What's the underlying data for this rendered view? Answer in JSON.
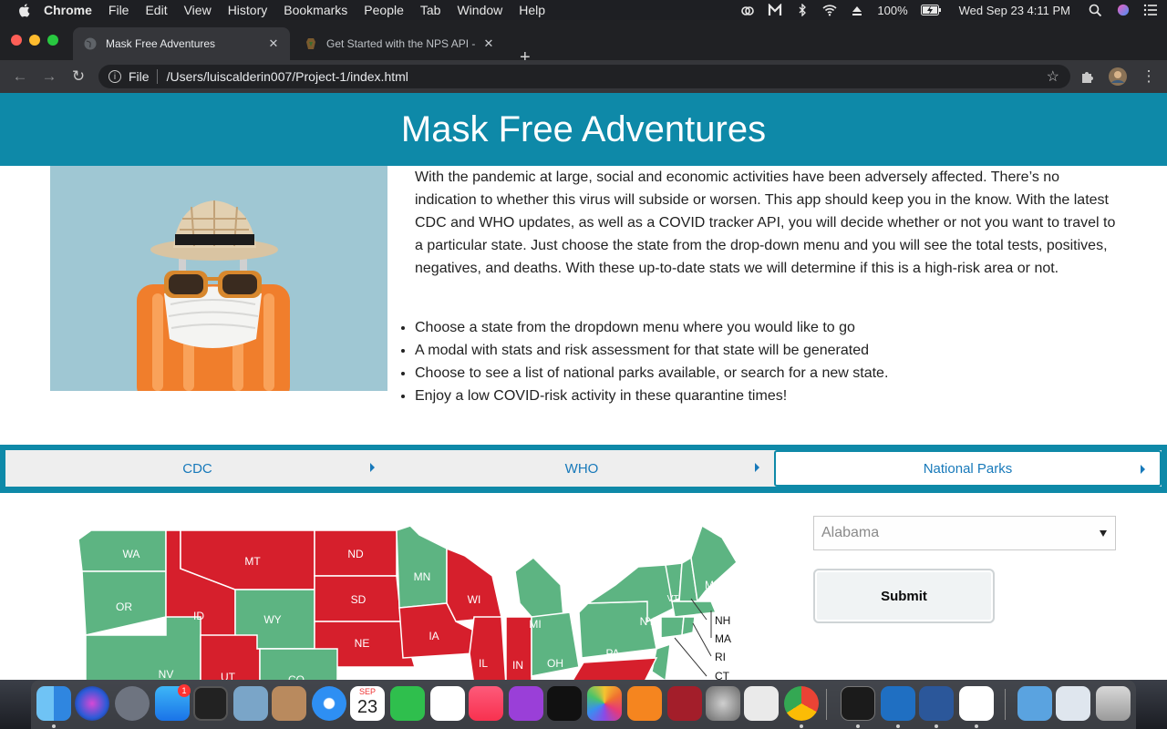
{
  "menubar": {
    "app": "Chrome",
    "items": [
      "File",
      "Edit",
      "View",
      "History",
      "Bookmarks",
      "People",
      "Tab",
      "Window",
      "Help"
    ],
    "battery": "100%",
    "clock": "Wed Sep 23  4:11 PM"
  },
  "browser": {
    "tabs": [
      {
        "title": "Mask Free Adventures"
      },
      {
        "title": "Get Started with the NPS API -"
      }
    ],
    "address": {
      "scheme": "File",
      "path": "/Users/luiscalderin007/Project-1/index.html"
    }
  },
  "page": {
    "title": "Mask Free Adventures",
    "intro": "With the pandemic at large, social and economic activities have been adversely affected. There’s no indication to whether this virus will subside or worsen. This app should keep you in the know. With the latest CDC and WHO updates, as well as a COVID tracker API, you will decide whether or not you want to travel to a particular state. Just choose the state from the drop-down menu and you will see the total tests, positives, negatives, and deaths. With these up-to-date stats we will determine if this is a high-risk area or not.",
    "features": [
      "Choose a state from the dropdown menu where you would like to go",
      "A modal with stats and risk assessment for that state will be generated",
      "Choose to see a list of national parks available, or search for a new state.",
      "Enjoy a low COVID-risk activity in these quarantine times!"
    ],
    "link_tabs": [
      {
        "label": "CDC"
      },
      {
        "label": "WHO"
      },
      {
        "label": "National Parks"
      }
    ],
    "state_select": {
      "value": "Alabama"
    },
    "submit_label": "Submit",
    "map_labels": {
      "WA": "WA",
      "OR": "OR",
      "ID": "ID",
      "MT": "MT",
      "WY": "WY",
      "ND": "ND",
      "SD": "SD",
      "NE": "NE",
      "NV": "NV",
      "UT": "UT",
      "CO": "CO",
      "MN": "MN",
      "WI": "WI",
      "IA": "IA",
      "IL": "IL",
      "IN": "IN",
      "MI": "MI",
      "OH": "OH",
      "PA": "PA",
      "NY": "NY",
      "VT": "VT",
      "ME": "ME",
      "NH": "NH",
      "MA": "MA",
      "RI": "RI",
      "CT": "CT"
    },
    "map_colors": {
      "low_risk": "#5db482",
      "high_risk": "#d61f2c"
    }
  },
  "dock": {
    "appstore_badge": "1",
    "calendar_month": "SEP",
    "calendar_day": "23"
  }
}
